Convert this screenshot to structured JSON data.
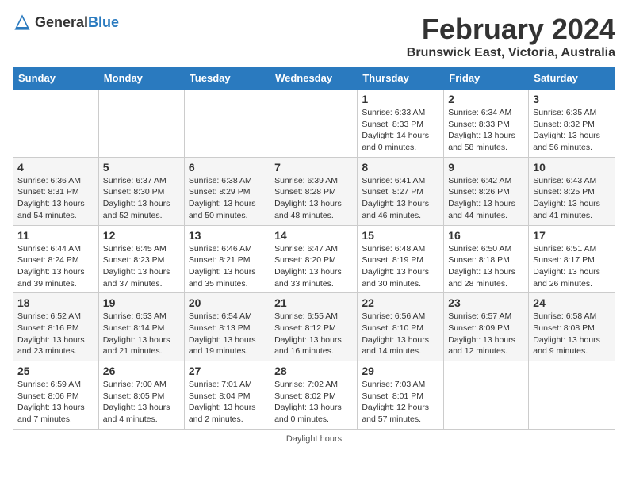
{
  "header": {
    "logo_general": "General",
    "logo_blue": "Blue",
    "title": "February 2024",
    "subtitle": "Brunswick East, Victoria, Australia"
  },
  "days_of_week": [
    "Sunday",
    "Monday",
    "Tuesday",
    "Wednesday",
    "Thursday",
    "Friday",
    "Saturday"
  ],
  "weeks": [
    [
      {
        "day": "",
        "info": ""
      },
      {
        "day": "",
        "info": ""
      },
      {
        "day": "",
        "info": ""
      },
      {
        "day": "",
        "info": ""
      },
      {
        "day": "1",
        "info": "Sunrise: 6:33 AM\nSunset: 8:33 PM\nDaylight: 14 hours\nand 0 minutes."
      },
      {
        "day": "2",
        "info": "Sunrise: 6:34 AM\nSunset: 8:33 PM\nDaylight: 13 hours\nand 58 minutes."
      },
      {
        "day": "3",
        "info": "Sunrise: 6:35 AM\nSunset: 8:32 PM\nDaylight: 13 hours\nand 56 minutes."
      }
    ],
    [
      {
        "day": "4",
        "info": "Sunrise: 6:36 AM\nSunset: 8:31 PM\nDaylight: 13 hours\nand 54 minutes."
      },
      {
        "day": "5",
        "info": "Sunrise: 6:37 AM\nSunset: 8:30 PM\nDaylight: 13 hours\nand 52 minutes."
      },
      {
        "day": "6",
        "info": "Sunrise: 6:38 AM\nSunset: 8:29 PM\nDaylight: 13 hours\nand 50 minutes."
      },
      {
        "day": "7",
        "info": "Sunrise: 6:39 AM\nSunset: 8:28 PM\nDaylight: 13 hours\nand 48 minutes."
      },
      {
        "day": "8",
        "info": "Sunrise: 6:41 AM\nSunset: 8:27 PM\nDaylight: 13 hours\nand 46 minutes."
      },
      {
        "day": "9",
        "info": "Sunrise: 6:42 AM\nSunset: 8:26 PM\nDaylight: 13 hours\nand 44 minutes."
      },
      {
        "day": "10",
        "info": "Sunrise: 6:43 AM\nSunset: 8:25 PM\nDaylight: 13 hours\nand 41 minutes."
      }
    ],
    [
      {
        "day": "11",
        "info": "Sunrise: 6:44 AM\nSunset: 8:24 PM\nDaylight: 13 hours\nand 39 minutes."
      },
      {
        "day": "12",
        "info": "Sunrise: 6:45 AM\nSunset: 8:23 PM\nDaylight: 13 hours\nand 37 minutes."
      },
      {
        "day": "13",
        "info": "Sunrise: 6:46 AM\nSunset: 8:21 PM\nDaylight: 13 hours\nand 35 minutes."
      },
      {
        "day": "14",
        "info": "Sunrise: 6:47 AM\nSunset: 8:20 PM\nDaylight: 13 hours\nand 33 minutes."
      },
      {
        "day": "15",
        "info": "Sunrise: 6:48 AM\nSunset: 8:19 PM\nDaylight: 13 hours\nand 30 minutes."
      },
      {
        "day": "16",
        "info": "Sunrise: 6:50 AM\nSunset: 8:18 PM\nDaylight: 13 hours\nand 28 minutes."
      },
      {
        "day": "17",
        "info": "Sunrise: 6:51 AM\nSunset: 8:17 PM\nDaylight: 13 hours\nand 26 minutes."
      }
    ],
    [
      {
        "day": "18",
        "info": "Sunrise: 6:52 AM\nSunset: 8:16 PM\nDaylight: 13 hours\nand 23 minutes."
      },
      {
        "day": "19",
        "info": "Sunrise: 6:53 AM\nSunset: 8:14 PM\nDaylight: 13 hours\nand 21 minutes."
      },
      {
        "day": "20",
        "info": "Sunrise: 6:54 AM\nSunset: 8:13 PM\nDaylight: 13 hours\nand 19 minutes."
      },
      {
        "day": "21",
        "info": "Sunrise: 6:55 AM\nSunset: 8:12 PM\nDaylight: 13 hours\nand 16 minutes."
      },
      {
        "day": "22",
        "info": "Sunrise: 6:56 AM\nSunset: 8:10 PM\nDaylight: 13 hours\nand 14 minutes."
      },
      {
        "day": "23",
        "info": "Sunrise: 6:57 AM\nSunset: 8:09 PM\nDaylight: 13 hours\nand 12 minutes."
      },
      {
        "day": "24",
        "info": "Sunrise: 6:58 AM\nSunset: 8:08 PM\nDaylight: 13 hours\nand 9 minutes."
      }
    ],
    [
      {
        "day": "25",
        "info": "Sunrise: 6:59 AM\nSunset: 8:06 PM\nDaylight: 13 hours\nand 7 minutes."
      },
      {
        "day": "26",
        "info": "Sunrise: 7:00 AM\nSunset: 8:05 PM\nDaylight: 13 hours\nand 4 minutes."
      },
      {
        "day": "27",
        "info": "Sunrise: 7:01 AM\nSunset: 8:04 PM\nDaylight: 13 hours\nand 2 minutes."
      },
      {
        "day": "28",
        "info": "Sunrise: 7:02 AM\nSunset: 8:02 PM\nDaylight: 13 hours\nand 0 minutes."
      },
      {
        "day": "29",
        "info": "Sunrise: 7:03 AM\nSunset: 8:01 PM\nDaylight: 12 hours\nand 57 minutes."
      },
      {
        "day": "",
        "info": ""
      },
      {
        "day": "",
        "info": ""
      }
    ]
  ],
  "footer": {
    "note": "Daylight hours"
  }
}
